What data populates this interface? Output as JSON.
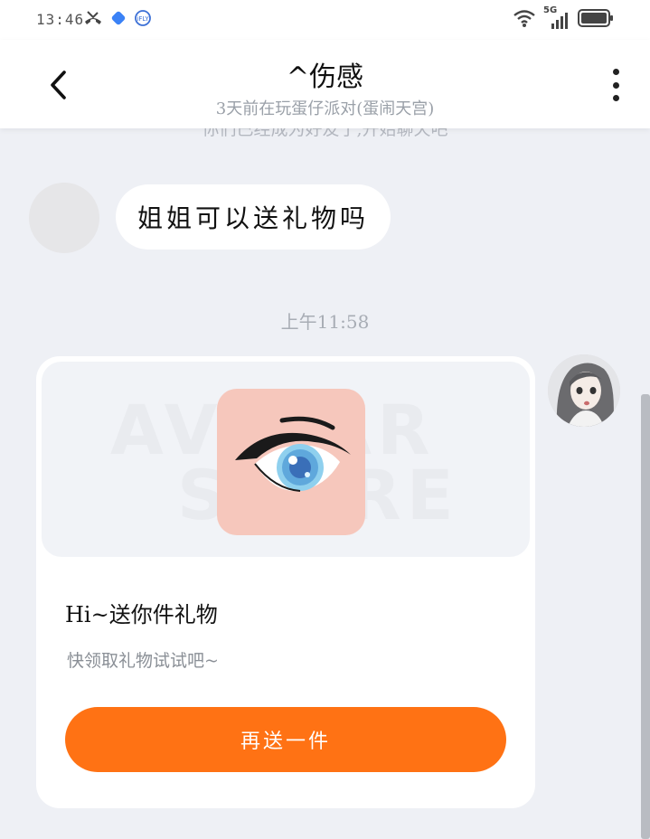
{
  "status_bar": {
    "time": "13:46",
    "network_label": "5G",
    "left_icons": [
      "missed-call-icon",
      "app-badge-icon",
      "ifly-icon"
    ],
    "right_icons": [
      "wifi-icon",
      "signal-icon",
      "battery-icon"
    ]
  },
  "header": {
    "back_icon": "chevron-left-icon",
    "title": "^伤感",
    "subtitle": "3天前在玩蛋仔派对(蛋闹天宫)",
    "more_icon": "more-vertical-icon"
  },
  "messages": {
    "partial_system_text": "你们已经成为好友了,开始聊天吧",
    "incoming_text": "姐姐可以送礼物吗",
    "timestamp": "上午11:58"
  },
  "gift_card": {
    "watermark_line1": "AVATAR",
    "watermark_line2": "STORE",
    "title": "Hi~送你件礼物",
    "description": "快领取礼物试试吧~",
    "button_label": "再送一件",
    "accent_color": "#ff7214",
    "tile_color": "#f6c7bc"
  }
}
